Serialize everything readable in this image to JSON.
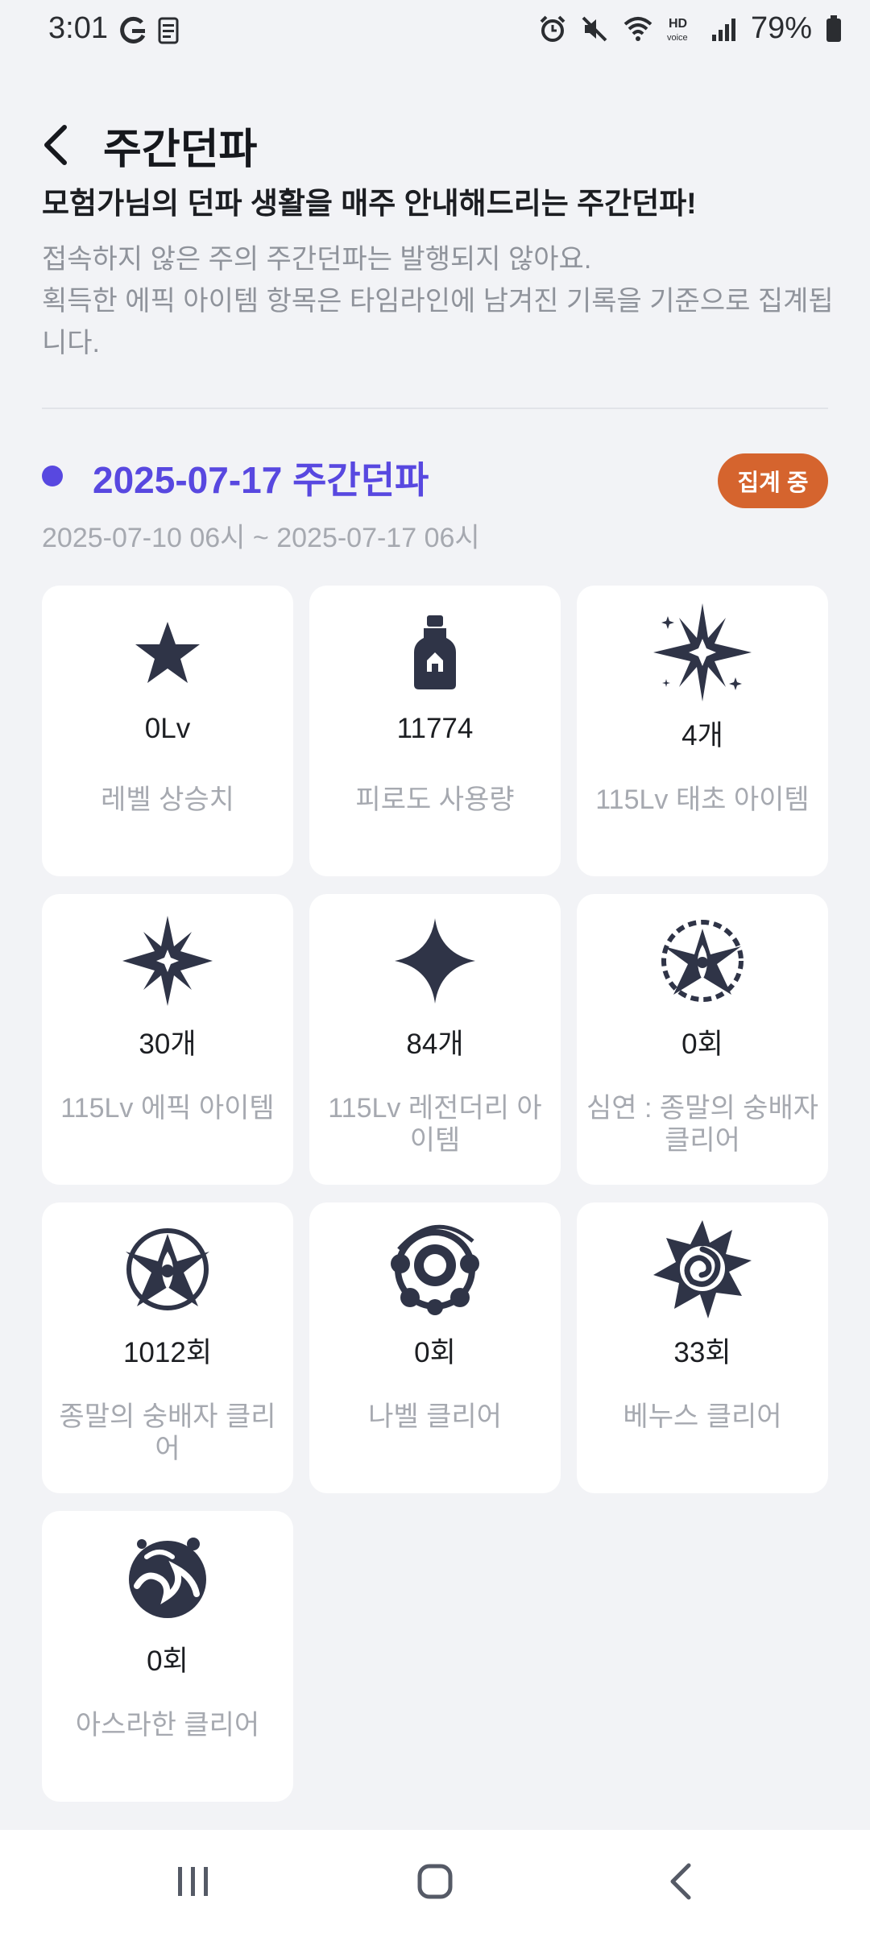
{
  "status": {
    "time": "3:01",
    "battery": "79%",
    "left_icons": [
      "g-icon",
      "bill-letter-icon"
    ],
    "right_icons": [
      "alarm-icon",
      "mute-icon",
      "wifi-icon",
      "hd-voice-icon",
      "signal-icon",
      "battery-icon"
    ]
  },
  "header": {
    "title": "주간던파",
    "back_icon": "chevron-left-icon"
  },
  "headline": "모험가님의 던파 생활을 매주 안내해드리는 주간던파!",
  "notice_lines": [
    "접속하지 않은 주의 주간던파는 발행되지 않아요.",
    "획득한 에픽 아이템 항목은 타임라인에 남겨진 기록을 기준으로 집계됩니다."
  ],
  "week": {
    "title": "2025-07-17 주간던파",
    "badge": "집계 중",
    "range": "2025-07-10 06시 ~ 2025-07-17 06시"
  },
  "stats": [
    {
      "icon": "star-icon",
      "value": "0Lv",
      "label": "레벨 상승치"
    },
    {
      "icon": "potion-bottle-icon",
      "value": "11774",
      "label": "피로도 사용량"
    },
    {
      "icon": "burst-star-icon",
      "value": "4개",
      "label": "115Lv 태초 아이템"
    },
    {
      "icon": "spiky-star-icon",
      "value": "30개",
      "label": "115Lv 에픽 아이템"
    },
    {
      "icon": "four-point-star-icon",
      "value": "84개",
      "label": "115Lv 레전더리 아이템"
    },
    {
      "icon": "abyss-crest-icon",
      "value": "0회",
      "label": "심연 : 종말의 숭배자 클리어"
    },
    {
      "icon": "cult-crest-icon",
      "value": "1012회",
      "label": "종말의 숭배자 클리어"
    },
    {
      "icon": "nabel-orb-icon",
      "value": "0회",
      "label": "나벨 클리어"
    },
    {
      "icon": "venus-rose-icon",
      "value": "33회",
      "label": "베누스 클리어"
    },
    {
      "icon": "asrahan-wave-icon",
      "value": "0회",
      "label": "아스라한 클리어"
    }
  ],
  "nav": [
    "recent-apps-icon",
    "home-icon",
    "back-icon"
  ]
}
